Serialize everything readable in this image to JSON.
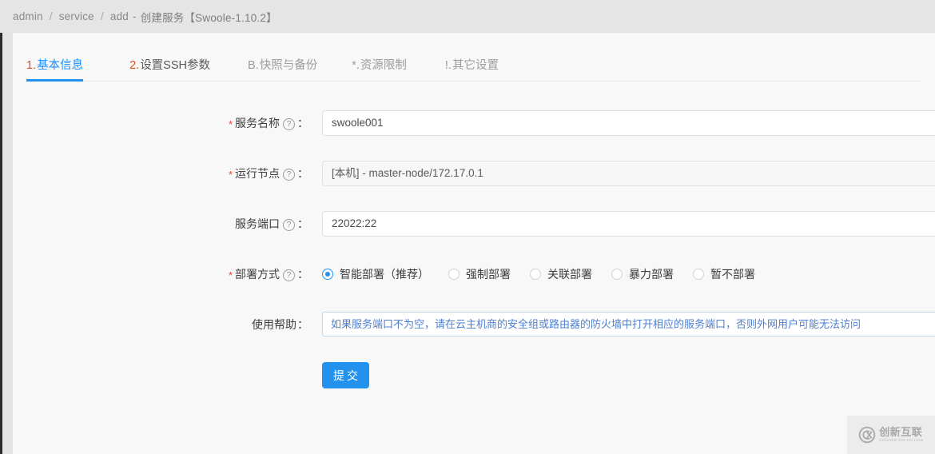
{
  "breadcrumb": {
    "items": [
      "admin",
      "service",
      "add"
    ],
    "separator": "/",
    "dash": "-",
    "title": "创建服务【Swoole-1.10.2】"
  },
  "tabs": [
    {
      "prefix": "1.",
      "label": "基本信息",
      "active": true
    },
    {
      "prefix": "2.",
      "label": "设置SSH参数",
      "active": false
    },
    {
      "prefix": "B.",
      "label": "快照与备份",
      "active": false
    },
    {
      "prefix": "*.",
      "label": "资源限制",
      "active": false
    },
    {
      "prefix": "!.",
      "label": "其它设置",
      "active": false
    }
  ],
  "form": {
    "help_icon": "?",
    "colon": "：",
    "required_mark": "*",
    "service_name": {
      "label": "服务名称",
      "value": "swoole001",
      "required": true
    },
    "run_node": {
      "label": "运行节点",
      "value": "[本机] - master-node/172.17.0.1",
      "required": true
    },
    "service_port": {
      "label": "服务端口",
      "value": "22022:22",
      "required": false
    },
    "deploy_mode": {
      "label": "部署方式",
      "required": true,
      "options": [
        {
          "label": "智能部署（推荐）",
          "checked": true
        },
        {
          "label": "强制部署",
          "checked": false
        },
        {
          "label": "关联部署",
          "checked": false
        },
        {
          "label": "暴力部署",
          "checked": false
        },
        {
          "label": "暂不部署",
          "checked": false
        }
      ]
    },
    "usage_help": {
      "label": "使用帮助",
      "text": "如果服务端口不为空，请在云主机商的安全组或路由器的防火墙中打开相应的服务端口，否则外网用户可能无法访问"
    },
    "submit_label": "提交"
  },
  "watermark": {
    "cn": "创新互联",
    "en": "CHUANG XIN HU LIAN",
    "logo": "cx-circle-logo"
  },
  "colors": {
    "accent": "#2392ef",
    "required": "#f04134",
    "tab_prefix": "#d9541e",
    "note_text": "#4d7fd0",
    "note_border": "#bbd6f5"
  }
}
